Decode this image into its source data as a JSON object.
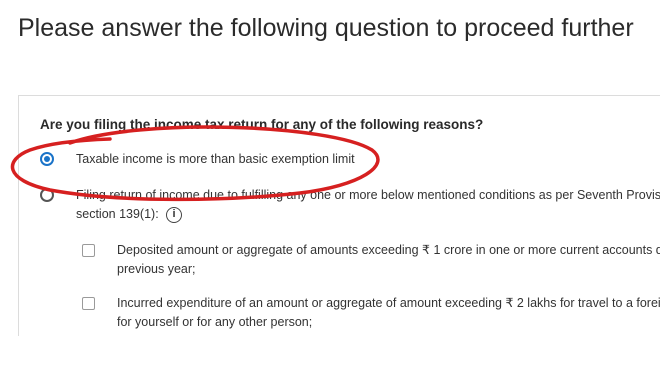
{
  "page": {
    "heading": "Please answer the following question to proceed further"
  },
  "form": {
    "question": "Are you filing the income tax return for any of the following reasons?",
    "options": [
      {
        "label": "Taxable income is more than basic exemption limit",
        "selected": true
      },
      {
        "label_line1": "Filing return of income due to fulfilling any one or more below mentioned conditions as per Seventh Proviso",
        "label_line2": "section 139(1):",
        "info_icon": "info-icon",
        "selected": false
      }
    ],
    "conditions": [
      {
        "line1": "Deposited amount or aggregate of amounts exceeding ₹ 1 crore in one or more current accounts du",
        "line2": "previous year;"
      },
      {
        "line1": "Incurred expenditure of an amount or aggregate of amount exceeding ₹ 2 lakhs for travel to a foreig",
        "line2": "for yourself or for any other person;"
      }
    ]
  },
  "colors": {
    "accent": "#1a73c8",
    "highlight_ellipse": "#d62020"
  }
}
